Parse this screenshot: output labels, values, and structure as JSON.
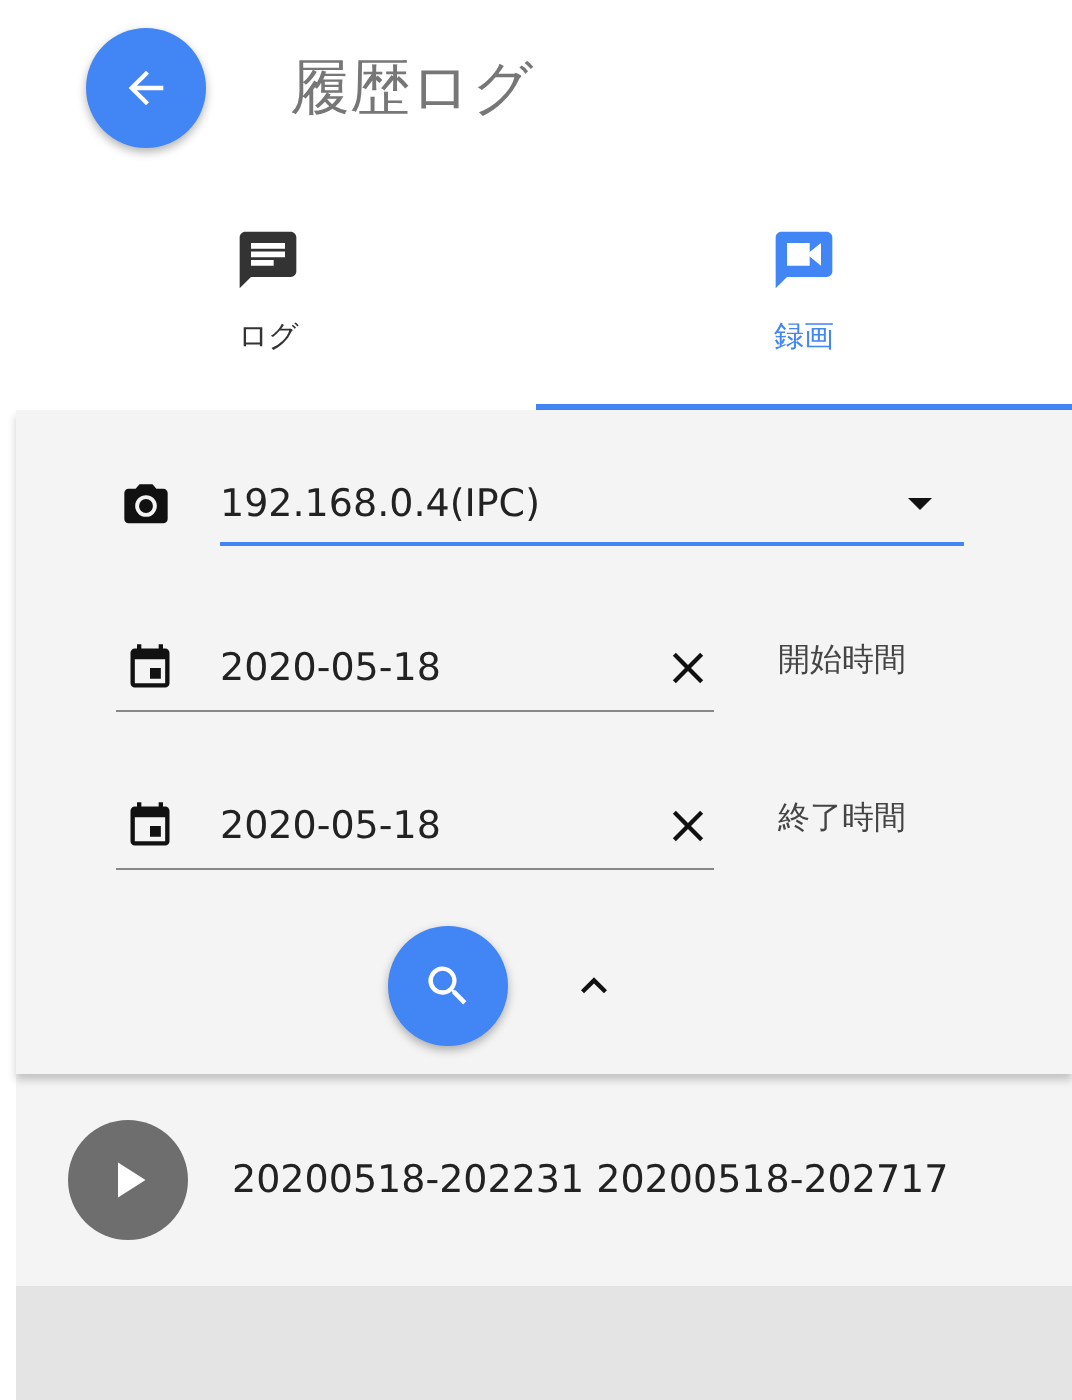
{
  "header": {
    "title": "履歴ログ"
  },
  "tabs": [
    {
      "label": "ログ",
      "kind": "message",
      "selected": false
    },
    {
      "label": "録画",
      "kind": "video",
      "selected": true
    }
  ],
  "filters": {
    "device": {
      "value": "192.168.0.4(IPC)",
      "focused": true
    },
    "dates": [
      {
        "value": "2020-05-18",
        "label": "開始時間"
      },
      {
        "value": "2020-05-18",
        "label": "終了時間"
      }
    ]
  },
  "recordings": [
    {
      "title": "20200518-202231 20200518-202717"
    }
  ]
}
